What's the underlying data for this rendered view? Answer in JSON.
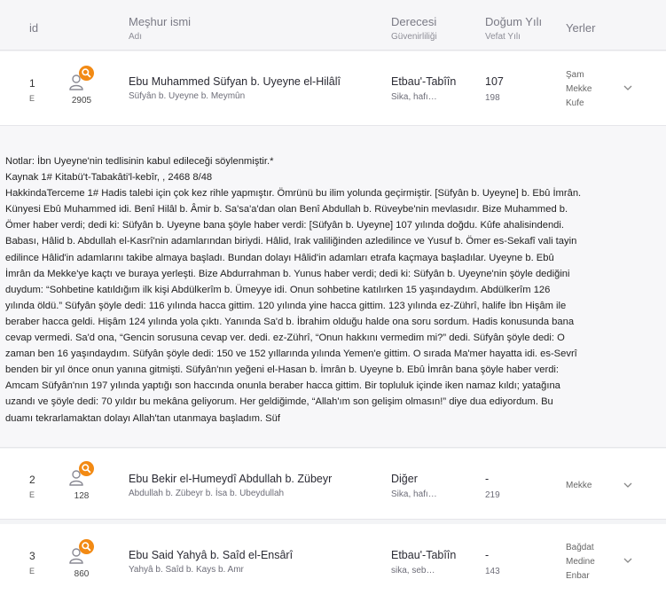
{
  "header": {
    "id": "id",
    "name": "Meşhur ismi",
    "name_sub": "Adı",
    "grade": "Derecesi",
    "grade_sub": "Güvenirliliği",
    "birth": "Doğum Yılı",
    "birth_sub": "Vefat Yılı",
    "places": "Yerler"
  },
  "rows": [
    {
      "id": "1",
      "tag": "E",
      "count": "2905",
      "name": "Ebu Muhammed Süfyan b. Uyeyne el-Hilâlî",
      "alt_name": "Süfyân b. Uyeyne b. Meymûn",
      "grade": "Etbau'-Tabîîn",
      "grade_sub": "Sika, hafı…",
      "birth": "107",
      "death": "198",
      "places": [
        "Şam",
        "Mekke",
        "Kufe"
      ]
    },
    {
      "id": "2",
      "tag": "E",
      "count": "128",
      "name": "Ebu Bekir el-Humeydî Abdullah b. Zübeyr",
      "alt_name": "Abdullah b. Zübeyr b. İsa b. Ubeydullah",
      "grade": "Diğer",
      "grade_sub": "Sika, hafı…",
      "birth": "-",
      "death": "219",
      "places": [
        "Mekke"
      ]
    },
    {
      "id": "3",
      "tag": "E",
      "count": "860",
      "name": "Ebu Said Yahyâ b. Saîd el-Ensârî",
      "alt_name": "Yahyâ b. Saîd b. Kays b. Amr",
      "grade": "Etbau'-Tabîîn",
      "grade_sub": "sika, seb…",
      "birth": "-",
      "death": "143",
      "places": [
        "Bağdat",
        "Medine",
        "Enbar"
      ]
    }
  ],
  "detail": {
    "lines": [
      "Notlar: İbn Uyeyne'nin tedlisinin kabul edileceği söylenmiştir.*",
      "Kaynak 1# Kitabü't-Tabakâti'l-kebîr, , 2468 8/48",
      "HakkindaTerceme 1# Hadis talebi için çok kez rihle yapmıştır. Ömrünü bu ilim yolunda geçirmiştir. [Süfyân b. Uyeyne] b. Ebû İmrân.",
      "Künyesi Ebû Muhammed idi. Benî Hilâl b. Âmir b. Sa'sa'a'dan olan Benî Abdullah b. Rüveybe'nin mevlasıdır. Bize Muhammed b.",
      "Ömer haber verdi; dedi ki: Süfyân b. Uyeyne bana şöyle haber verdi: [Süfyân b. Uyeyne] 107 yılında doğdu. Kûfe ahalisindendi.",
      "Babası, Hâlid b. Abdullah el-Kasrî'nin adamlarından biriydi. Hâlid, Irak valiliğinden azledilince ve Yusuf b. Ömer es-Sekafî vali tayin",
      "edilince Hâlid'in adamlarını takibe almaya başladı. Bundan dolayı Hâlid'in adamları etrafa kaçmaya başladılar. Uyeyne b. Ebû",
      "İmrân da Mekke'ye kaçtı ve buraya yerleşti. Bize Abdurrahman b. Yunus haber verdi; dedi ki: Süfyân b. Uyeyne'nin şöyle dediğini",
      "duydum: “Sohbetine katıldığım ilk kişi Abdülkerîm b. Ümeyye idi. Onun sohbetine katılırken 15 yaşındaydım. Abdülkerîm 126",
      "yılında öldü.” Süfyân şöyle dedi: 116 yılında hacca gittim. 120 yılında yine hacca gittim. 123 yılında ez-Zührî, halife İbn Hişâm ile",
      "beraber hacca geldi. Hişâm 124 yılında yola çıktı. Yanında Sa'd b. İbrahim olduğu halde ona soru sordum. Hadis konusunda bana",
      "cevap vermedi. Sa'd ona, “Gencin sorusuna cevap ver. dedi. ez-Zührî, “Onun hakkını vermedim mi?” dedi. Süfyân şöyle dedi: O",
      "zaman ben 16 yaşındaydım. Süfyân şöyle dedi: 150 ve 152 yıllarında yılında Yemen'e gittim. O sırada Ma'mer hayatta idi. es-Sevrî",
      "benden bir yıl önce onun yanına gitmişti. Süfyân'nın yeğeni el-Hasan b. İmrân b. Uyeyne b. Ebû İmrân bana şöyle haber verdi:",
      "Amcam Süfyân'nın 197 yılında yaptığı son haccında onunla beraber hacca gittim. Bir topluluk içinde iken namaz kıldı; yatağına",
      "uzandı ve şöyle dedi: 70 yıldır bu mekâna geliyorum. Her geldiğimde, “Allah'ım son gelişim olmasın!” diye dua ediyordum. Bu",
      "duamı tekrarlamaktan dolayı Allah'tan utanmaya başladım. Süf"
    ]
  },
  "icons": {
    "avatar": "person-outline-icon",
    "badge": "search-icon",
    "expand": "chevron-down-icon",
    "badge_color": "#f28a14"
  }
}
